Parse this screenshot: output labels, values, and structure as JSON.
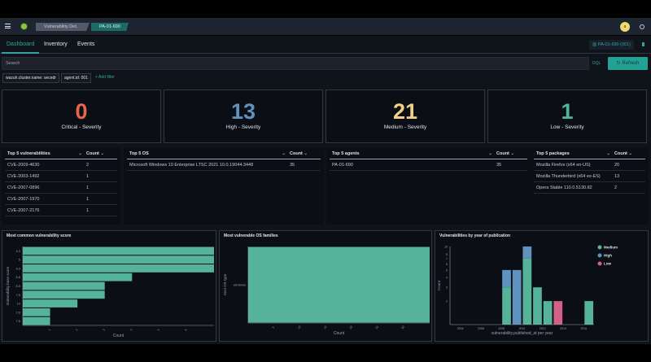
{
  "header": {
    "breadcrumbs": [
      "Vulnerability Det.",
      "PA-01-690"
    ],
    "avatar": "a",
    "menu_icon": "hamburger-icon",
    "logo_icon": "wazuh-logo-icon",
    "help_icon": "help-icon"
  },
  "tabs": [
    {
      "label": "Dashboard",
      "active": true
    },
    {
      "label": "Inventory"
    },
    {
      "label": "Events"
    }
  ],
  "agent_selector": {
    "label": "PA-01-690 (001)"
  },
  "search": {
    "placeholder": "Search",
    "language": "DQL",
    "refresh_label": "Refresh"
  },
  "filters": [
    {
      "label": "wazuh.cluster.name: secedr"
    },
    {
      "label": "agent.id: 001"
    }
  ],
  "add_filter": "+ Add filter",
  "severity": [
    {
      "count": "0",
      "label": "Critical - Severity",
      "color": "#e7664c"
    },
    {
      "count": "13",
      "label": "High - Severity",
      "color": "#6092c0"
    },
    {
      "count": "21",
      "label": "Medium - Severity",
      "color": "#f1d086"
    },
    {
      "count": "1",
      "label": "Low - Severity",
      "color": "#54b399"
    }
  ],
  "tables": [
    {
      "title": "Top 5 vulnerabilities",
      "count_label": "Count",
      "rows": [
        [
          "CVE-2009-4630",
          "2"
        ],
        [
          "CVE-2003-1492",
          "1"
        ],
        [
          "CVE-2007-0896",
          "1"
        ],
        [
          "CVE-2007-1970",
          "1"
        ],
        [
          "CVE-2007-2176",
          "1"
        ]
      ]
    },
    {
      "title": "Top 5 OS",
      "count_label": "Count",
      "rows": [
        [
          "Microsoft Windows 10 Enterprise LTSC 2021 10.0.19044.3448",
          "35"
        ]
      ]
    },
    {
      "title": "Top 5 agents",
      "count_label": "Count",
      "rows": [
        [
          "PA-01-690",
          "35"
        ]
      ]
    },
    {
      "title": "Top 5 packages",
      "count_label": "Count",
      "rows": [
        [
          "Mozilla Firefox (x64 en-US)",
          "20"
        ],
        [
          "Mozilla Thunderbird (x64 es-ES)",
          "13"
        ],
        [
          "Opera Stable 110.0.5130.82",
          "2"
        ]
      ]
    }
  ],
  "chart_data": [
    {
      "type": "bar",
      "orientation": "horizontal",
      "title": "Most common vulnerability score",
      "xlabel": "Count",
      "ylabel": "Vulnerability base score",
      "categories": [
        "4.3",
        "5",
        "9.3",
        "6.8",
        "5.5",
        "7.5",
        "10",
        "2.6",
        "7.6"
      ],
      "values": [
        7,
        7,
        7,
        4,
        3,
        3,
        2,
        1,
        1
      ],
      "xticks": [
        1,
        2,
        3,
        4,
        5,
        6
      ],
      "xlim": [
        0,
        7
      ],
      "color": "#54b399"
    },
    {
      "type": "bar",
      "orientation": "horizontal",
      "title": "Most vulnerable OS families",
      "xlabel": "Count",
      "ylabel": "Host OS type",
      "categories": [
        "windows"
      ],
      "values": [
        35
      ],
      "xticks": [
        5,
        10,
        15,
        20,
        25,
        30
      ],
      "xlim": [
        0,
        35
      ],
      "color": "#54b399"
    },
    {
      "type": "bar",
      "stacked": true,
      "title": "Vulnerabilities by year of publication",
      "xlabel": "vulnerability.published_at per year",
      "ylabel": "Count",
      "yscale": "log",
      "ylim": [
        1,
        10
      ],
      "yticks": [
        2,
        3,
        4,
        5,
        6,
        7,
        8,
        10
      ],
      "xticks": [
        2004,
        2006,
        2008,
        2010,
        2012,
        2014,
        2016
      ],
      "xlim": [
        2003,
        2017
      ],
      "legend": "top-right",
      "categories": [
        2008,
        2009,
        2010,
        2011,
        2012,
        2013,
        2016
      ],
      "series": [
        {
          "name": "Medium",
          "color": "#54b399",
          "values": [
            3,
            0,
            7,
            3,
            2,
            0,
            2
          ]
        },
        {
          "name": "High",
          "color": "#6092c0",
          "values": [
            2,
            5,
            3,
            0,
            0,
            0,
            0
          ]
        },
        {
          "name": "Low",
          "color": "#d36086",
          "values": [
            0,
            0,
            0,
            0,
            0,
            2,
            0
          ]
        }
      ]
    }
  ]
}
